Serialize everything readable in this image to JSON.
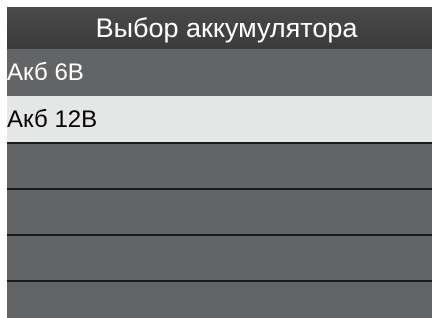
{
  "menu": {
    "title": "Выбор аккумулятора",
    "items": [
      {
        "label": "Акб 6В",
        "selected": false
      },
      {
        "label": "Акб 12В",
        "selected": true
      }
    ],
    "empty_rows": 4
  },
  "colors": {
    "background": "#636466",
    "title_bar": "#404040",
    "selected_row": "#e5e6e6",
    "divider": "#1a1a1a",
    "text": "#ffffff",
    "selected_text": "#000000"
  }
}
